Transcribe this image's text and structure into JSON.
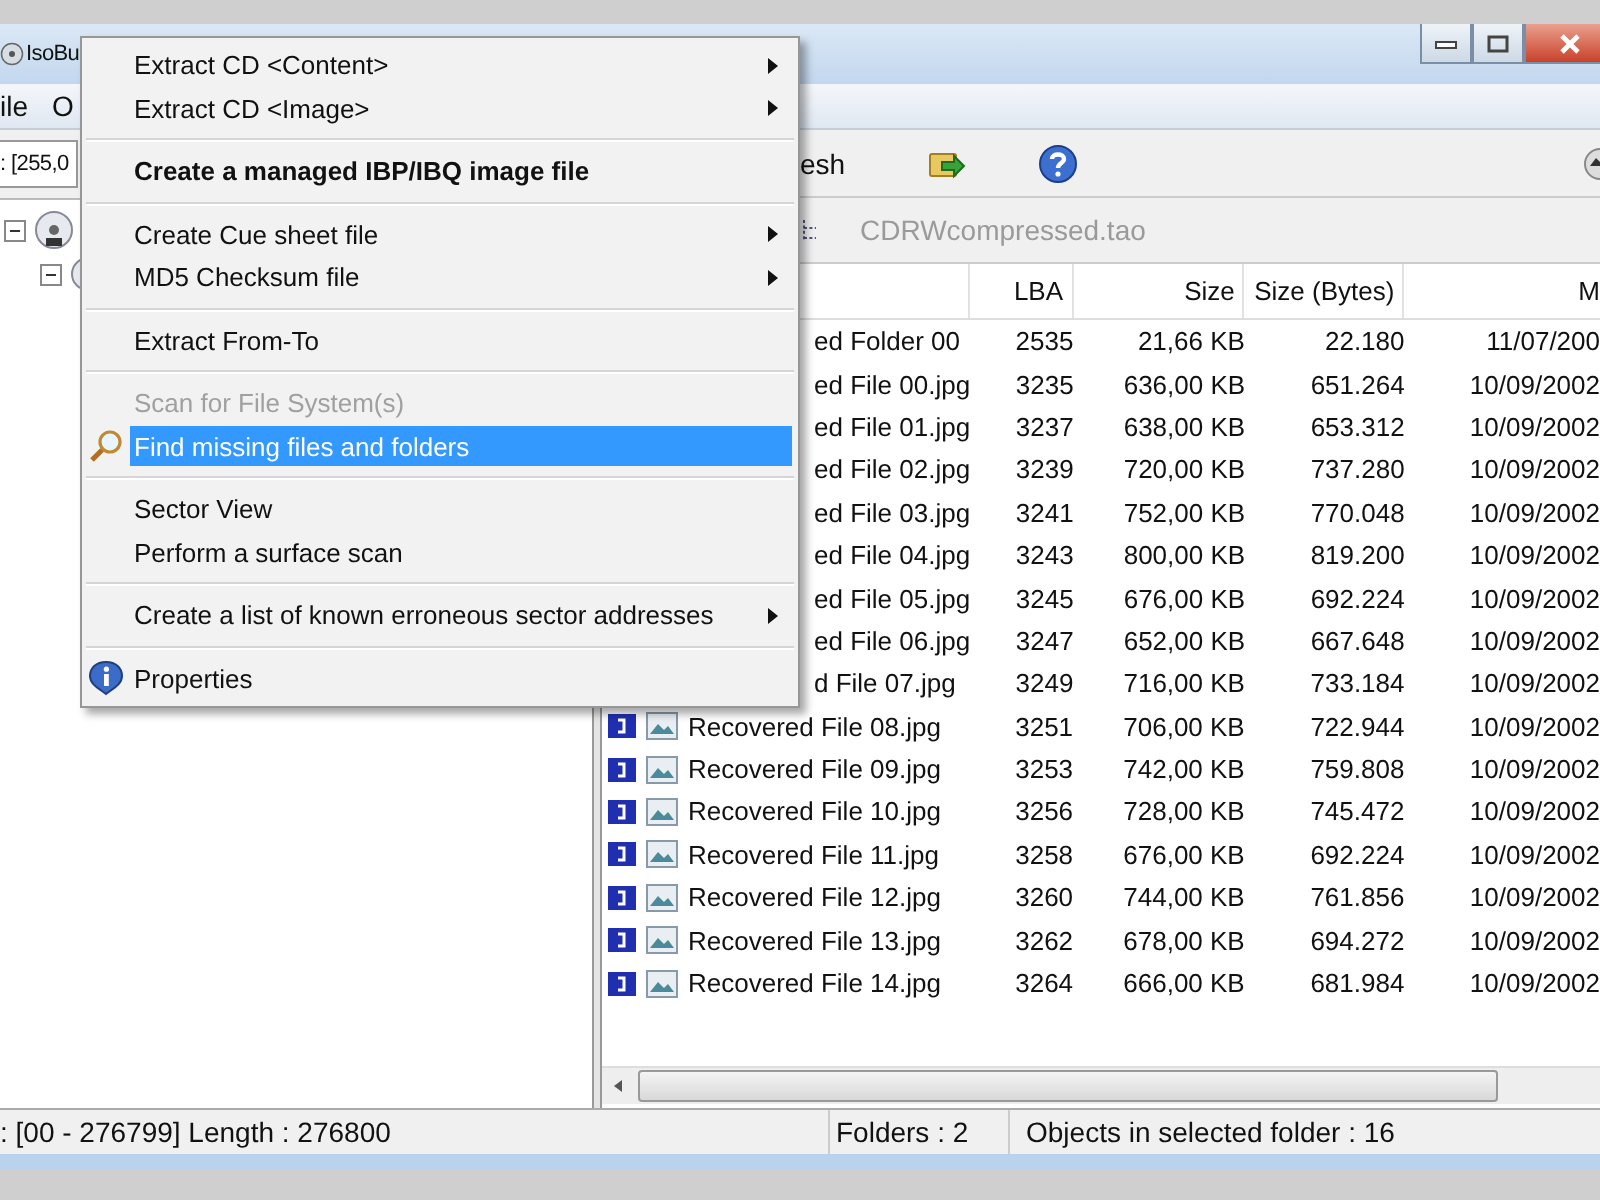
{
  "window": {
    "title": "IsoBu"
  },
  "menu_bar": [
    "ile",
    "O"
  ],
  "address": {
    "value": ": [255,0"
  },
  "tree": [
    {
      "expanded": true,
      "children": [
        {
          "expanded": true
        }
      ]
    }
  ],
  "toolbar": {
    "refresh_label": "esh"
  },
  "path": "CDRWcompressed.tao",
  "table": {
    "columns": [
      "LBA",
      "Size",
      "Size (Bytes)",
      "M"
    ],
    "rows": [
      {
        "name": "ed Folder 00",
        "covered": true,
        "lba": "2535",
        "size": "21,66 KB",
        "bytes": "22.180",
        "date": "11/07/200"
      },
      {
        "name": "ed File 00.jpg",
        "covered": true,
        "lba": "3235",
        "size": "636,00 KB",
        "bytes": "651.264",
        "date": "10/09/2002"
      },
      {
        "name": "ed File 01.jpg",
        "covered": true,
        "lba": "3237",
        "size": "638,00 KB",
        "bytes": "653.312",
        "date": "10/09/2002"
      },
      {
        "name": "ed File 02.jpg",
        "covered": true,
        "lba": "3239",
        "size": "720,00 KB",
        "bytes": "737.280",
        "date": "10/09/2002"
      },
      {
        "name": "ed File 03.jpg",
        "covered": true,
        "lba": "3241",
        "size": "752,00 KB",
        "bytes": "770.048",
        "date": "10/09/2002"
      },
      {
        "name": "ed File 04.jpg",
        "covered": true,
        "lba": "3243",
        "size": "800,00 KB",
        "bytes": "819.200",
        "date": "10/09/2002"
      },
      {
        "name": "ed File 05.jpg",
        "covered": true,
        "lba": "3245",
        "size": "676,00 KB",
        "bytes": "692.224",
        "date": "10/09/2002"
      },
      {
        "name": "ed File 06.jpg",
        "covered": true,
        "lba": "3247",
        "size": "652,00 KB",
        "bytes": "667.648",
        "date": "10/09/2002"
      },
      {
        "name": "d File 07.jpg",
        "covered": true,
        "lba": "3249",
        "size": "716,00 KB",
        "bytes": "733.184",
        "date": "10/09/2002"
      },
      {
        "name": "Recovered File 08.jpg",
        "covered": false,
        "lba": "3251",
        "size": "706,00 KB",
        "bytes": "722.944",
        "date": "10/09/2002"
      },
      {
        "name": "Recovered File 09.jpg",
        "covered": false,
        "lba": "3253",
        "size": "742,00 KB",
        "bytes": "759.808",
        "date": "10/09/2002"
      },
      {
        "name": "Recovered File 10.jpg",
        "covered": false,
        "lba": "3256",
        "size": "728,00 KB",
        "bytes": "745.472",
        "date": "10/09/2002"
      },
      {
        "name": "Recovered File 11.jpg",
        "covered": false,
        "lba": "3258",
        "size": "676,00 KB",
        "bytes": "692.224",
        "date": "10/09/2002"
      },
      {
        "name": "Recovered File 12.jpg",
        "covered": false,
        "lba": "3260",
        "size": "744,00 KB",
        "bytes": "761.856",
        "date": "10/09/2002"
      },
      {
        "name": "Recovered File 13.jpg",
        "covered": false,
        "lba": "3262",
        "size": "678,00 KB",
        "bytes": "694.272",
        "date": "10/09/2002"
      },
      {
        "name": "Recovered File 14.jpg",
        "covered": false,
        "lba": "3264",
        "size": "666,00 KB",
        "bytes": "681.984",
        "date": "10/09/2002"
      }
    ]
  },
  "status_bar": [
    ": [00 - 276799]  Length : 276800",
    "Folders : 2",
    "Objects in selected folder : 16"
  ],
  "context_menu": [
    {
      "kind": "submenu",
      "label": "Extract CD  <Content>",
      "disabled": false,
      "selected": false
    },
    {
      "kind": "submenu",
      "label": "Extract CD  <Image>",
      "disabled": false,
      "selected": false
    },
    {
      "kind": "separator"
    },
    {
      "kind": "bold",
      "label": "Create a managed IBP/IBQ image file",
      "disabled": false,
      "selected": false
    },
    {
      "kind": "separator"
    },
    {
      "kind": "submenu",
      "label": "Create Cue sheet file",
      "disabled": false,
      "selected": false
    },
    {
      "kind": "submenu",
      "label": "MD5 Checksum file",
      "disabled": false,
      "selected": false
    },
    {
      "kind": "separator"
    },
    {
      "kind": "command",
      "label": "Extract From-To",
      "disabled": false,
      "selected": false
    },
    {
      "kind": "separator"
    },
    {
      "kind": "command",
      "label": "Scan for File System(s)",
      "disabled": true,
      "selected": false
    },
    {
      "kind": "search",
      "label": "Find missing files and folders",
      "disabled": false,
      "selected": true
    },
    {
      "kind": "separator"
    },
    {
      "kind": "command",
      "label": "Sector View",
      "disabled": false,
      "selected": false
    },
    {
      "kind": "command",
      "label": "Perform a surface scan",
      "disabled": false,
      "selected": false
    },
    {
      "kind": "separator"
    },
    {
      "kind": "submenu",
      "label": "Create a list of known erroneous sector addresses",
      "disabled": false,
      "selected": false
    },
    {
      "kind": "separator"
    },
    {
      "kind": "info",
      "label": "Properties",
      "disabled": false,
      "selected": false
    }
  ]
}
